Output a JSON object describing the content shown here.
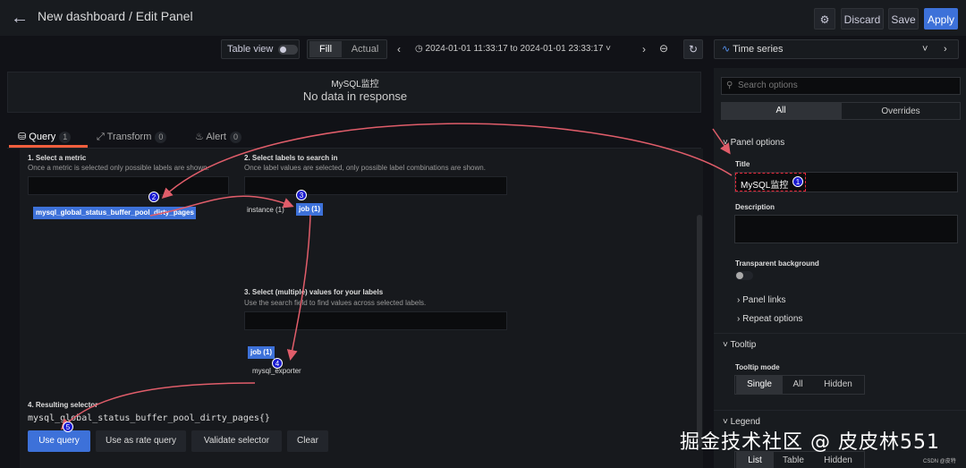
{
  "header": {
    "title": "New dashboard / Edit Panel",
    "discard": "Discard",
    "save": "Save",
    "apply": "Apply"
  },
  "toolbar": {
    "table_view": "Table view",
    "fill": "Fill",
    "actual": "Actual",
    "time_range": "2024-01-01 11:33:17 to 2024-01-01 23:33:17",
    "visualization": "Time series"
  },
  "preview": {
    "title": "MySQL监控",
    "message": "No data in response"
  },
  "tabs": [
    {
      "label": "Query",
      "count": "1"
    },
    {
      "label": "Transform",
      "count": "0"
    },
    {
      "label": "Alert",
      "count": "0"
    }
  ],
  "query_builder": {
    "step1_title": "1. Select a metric",
    "step1_sub": "Once a metric is selected only possible labels are shown.",
    "metric_chip": "mysql_global_status_buffer_pool_dirty_pages",
    "step2_title": "2. Select labels to search in",
    "step2_sub": "Once label values are selected, only possible label combinations are shown.",
    "label_instance": "instance (1)",
    "label_job": "job (1)",
    "step3_title": "3. Select (multiple) values for your labels",
    "step3_sub": "Use the search field to find values across selected labels.",
    "values_chip": "job (1)",
    "value_item": "mysql_exporter",
    "step4_title": "4. Resulting selector",
    "selector": "mysql_global_status_buffer_pool_dirty_pages{}",
    "use_query": "Use query",
    "use_rate": "Use as rate query",
    "validate": "Validate selector",
    "clear": "Clear"
  },
  "annotations": [
    "1",
    "2",
    "3",
    "4",
    "5"
  ],
  "options": {
    "search_placeholder": "Search options",
    "all": "All",
    "overrides": "Overrides",
    "panel_options": "Panel options",
    "title_label": "Title",
    "title_value": "MySQL监控",
    "description_label": "Description",
    "transparent_label": "Transparent background",
    "panel_links": "Panel links",
    "repeat_options": "Repeat options",
    "tooltip": "Tooltip",
    "tooltip_mode": "Tooltip mode",
    "single": "Single",
    "all_mode": "All",
    "hidden": "Hidden",
    "legend": "Legend",
    "list": "List",
    "table": "Table",
    "hidden2": "Hidden"
  },
  "watermark": "掘金技术社区 @ 皮皮林551",
  "csdn": "CSDN @皮特",
  "colors": {
    "accent": "#3d71d9",
    "annotation_red": "#e05d6a"
  }
}
